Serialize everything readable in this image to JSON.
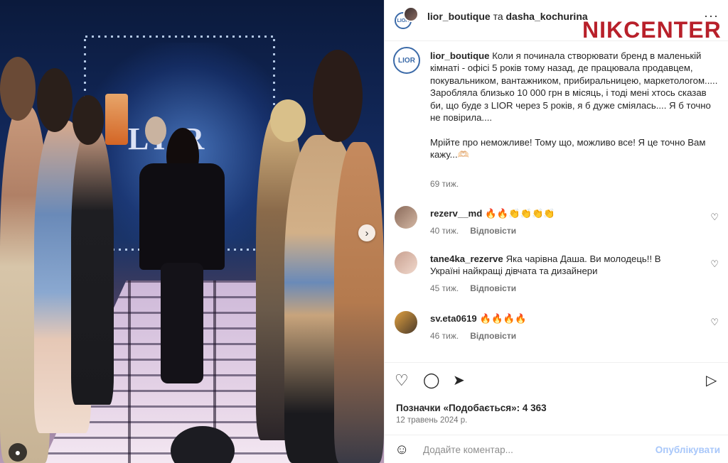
{
  "post": {
    "header": {
      "user1": "lior_boutique",
      "connector": "та",
      "user2": "dasha_kochurina",
      "more_icon": "more-horizontal-icon"
    },
    "watermark": "NIKCENTER",
    "stage_logo": "LI R",
    "caption": {
      "avatar_text": "LIOR",
      "username": "lior_boutique",
      "text": "Коли я починала створювати бренд в маленькій кімнаті - офісі 5 років тому назад, де працювала продавцем, покувальником, вантажником, прибиральницею, маркетологом.....\nЗаробляла близько 10 000 грн в місяць, і тоді мені хтось сказав би, що буде з LIOR через 5 років, я б дуже сміялась.... Я б точно не повірила....\n\nМрійте про неможливе! Тому що, можливо все! Я це точно Вам кажу...🫶🏻",
      "time": "69 тиж."
    },
    "comments": [
      {
        "username": "rezerv__md",
        "text": "🔥🔥👏👏👏👏",
        "time": "40 тиж.",
        "reply": "Відповісти",
        "avatar_color": "#b89a86"
      },
      {
        "username": "tane4ka_rezerve",
        "text": "Яка чарівна Даша. Ви молодець!! В Україні найкращі дівчата та дизайнери",
        "time": "45 тиж.",
        "reply": "Відповісти",
        "avatar_color": "#c79a8a"
      },
      {
        "username": "sv.eta0619",
        "text": "🔥🔥🔥🔥",
        "time": "46 тиж.",
        "reply": "Відповісти",
        "avatar_color": "#7a6a4a"
      }
    ],
    "actions": {
      "like_icon": "heart-icon",
      "comment_icon": "comment-icon",
      "share_icon": "send-icon",
      "save_icon": "bookmark-icon"
    },
    "likes": "Позначки «Подобається»: 4 363",
    "date": "12 травень 2024 р.",
    "add_comment": {
      "placeholder": "Додайте коментар...",
      "post_label": "Опублікувати",
      "emoji_icon": "smiley-icon"
    },
    "colors": {
      "brand_red": "#b8202a",
      "post_button": "#a8c7fa",
      "secondary_text": "#737373"
    }
  }
}
